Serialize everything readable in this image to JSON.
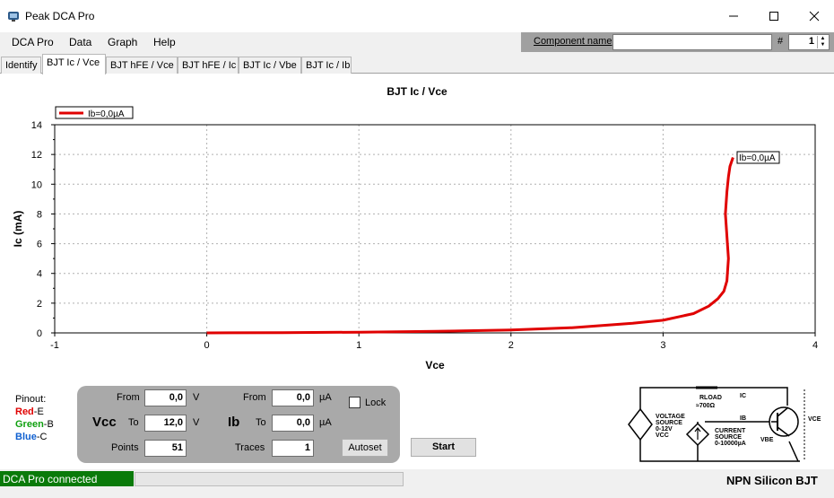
{
  "window": {
    "title": "Peak DCA Pro",
    "minimize_icon": "minimize-icon",
    "maximize_icon": "maximize-icon",
    "close_icon": "close-icon"
  },
  "menu": {
    "items": [
      "DCA Pro",
      "Data",
      "Graph",
      "Help"
    ]
  },
  "component": {
    "label": "Component name",
    "value": "",
    "hash": "#",
    "number": "1"
  },
  "tabs": [
    {
      "label": "Identify",
      "active": false
    },
    {
      "label": "BJT Ic / Vce",
      "active": true
    },
    {
      "label": "BJT hFE / Vce",
      "active": false
    },
    {
      "label": "BJT hFE / Ic",
      "active": false
    },
    {
      "label": "BJT Ic / Vbe",
      "active": false
    },
    {
      "label": "BJT Ic / Ib",
      "active": false
    }
  ],
  "chart_data": {
    "type": "line",
    "title": "BJT Ic / Vce",
    "xlabel": "Vce",
    "ylabel": "Ic (mA)",
    "xlim": [
      -1,
      4
    ],
    "ylim": [
      0,
      14
    ],
    "xticks": [
      -1,
      0,
      1,
      2,
      3,
      4
    ],
    "yticks": [
      0,
      2,
      4,
      6,
      8,
      10,
      12,
      14
    ],
    "xtick_labels": [
      "-1",
      "0",
      "1",
      "2",
      "3",
      "4"
    ],
    "ytick_labels": [
      "0",
      "2",
      "4",
      "6",
      "8",
      "10",
      "12",
      "14"
    ],
    "grid": true,
    "legend_position": "top-left",
    "series": [
      {
        "name": "Ib=0,0µA",
        "color": "#e00000",
        "x": [
          0,
          0.5,
          1.0,
          1.5,
          2.0,
          2.4,
          2.8,
          3.0,
          3.2,
          3.3,
          3.36,
          3.4,
          3.42,
          3.43,
          3.42,
          3.41,
          3.42,
          3.43,
          3.44,
          3.46
        ],
        "y": [
          0.0,
          0.02,
          0.05,
          0.1,
          0.2,
          0.35,
          0.65,
          0.85,
          1.3,
          1.8,
          2.3,
          2.8,
          3.5,
          5.0,
          6.5,
          8.0,
          9.5,
          10.5,
          11.2,
          11.8
        ]
      }
    ],
    "annotations": [
      {
        "text": "Ib=0,0µA",
        "x": 3.46,
        "y": 11.8
      }
    ]
  },
  "pinout": {
    "title": "Pinout:",
    "pins": [
      {
        "color_name": "Red",
        "pin": "-E",
        "color": "#e00000"
      },
      {
        "color_name": "Green",
        "pin": "-B",
        "color": "#10a010"
      },
      {
        "color_name": "Blue",
        "pin": "-C",
        "color": "#1060d0"
      }
    ]
  },
  "controls": {
    "vcc_label": "Vcc",
    "ib_label": "Ib",
    "from_label": "From",
    "to_label": "To",
    "points_label": "Points",
    "traces_label": "Traces",
    "vcc_from": "0,0",
    "vcc_to": "12,0",
    "vcc_unit": "V",
    "ib_from": "0,0",
    "ib_to": "0,0",
    "ib_unit": "µA",
    "points": "51",
    "traces": "1",
    "lock_label": "Lock",
    "autoset_label": "Autoset",
    "start_label": "Start"
  },
  "circuit": {
    "rload": "RLOAD",
    "rload_val": "≈700Ω",
    "ic": "IC",
    "ib": "IB",
    "vs_line1": "VOLTAGE",
    "vs_line2": "SOURCE",
    "vs_line3": "0-12V",
    "vs_line4": "VCC",
    "cs_line1": "CURRENT",
    "cs_line2": "SOURCE",
    "cs_line3": "0-10000µA",
    "vbe": "VBE",
    "vce": "VCE"
  },
  "status": {
    "connection": "DCA Pro connected",
    "progress": 0,
    "device": "NPN Silicon BJT"
  }
}
